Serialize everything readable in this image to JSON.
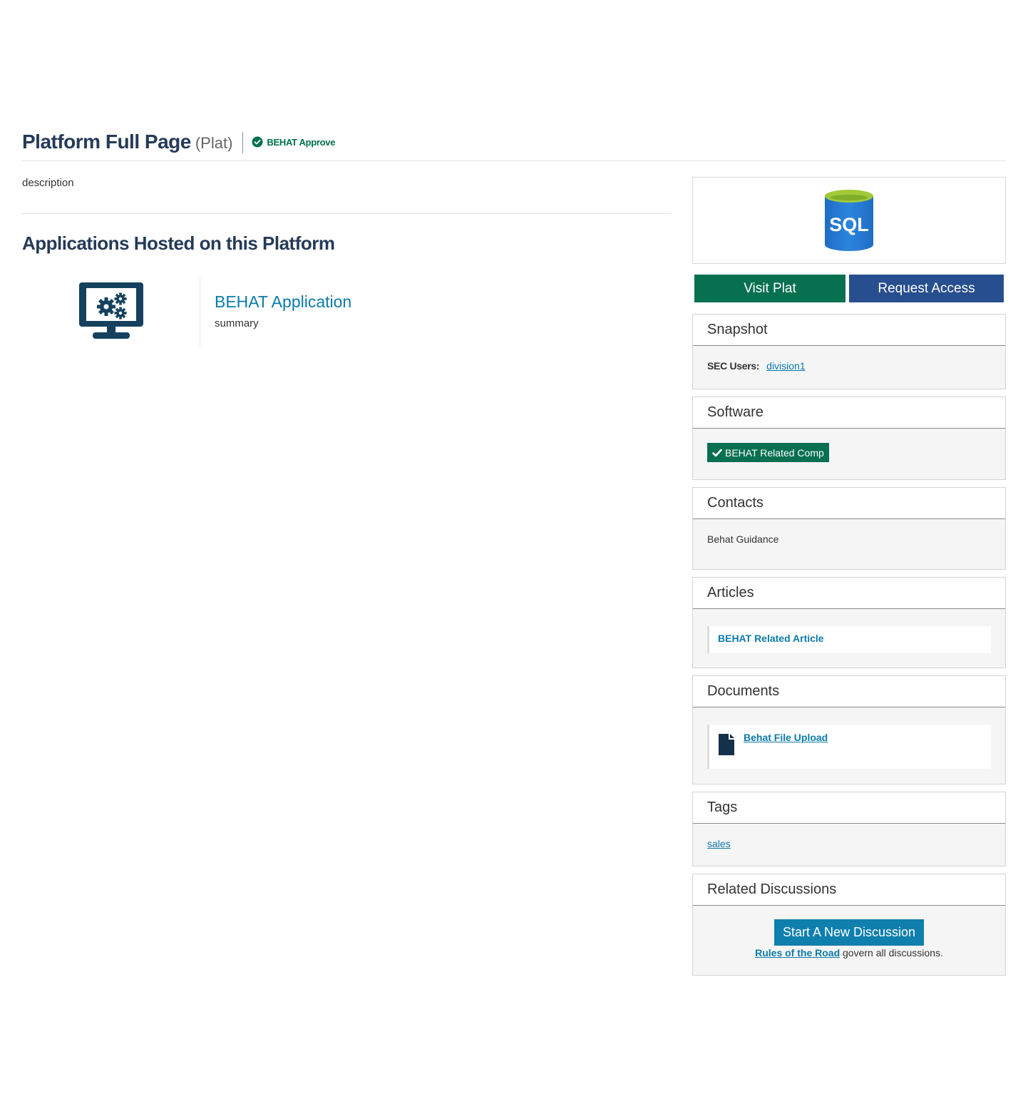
{
  "header": {
    "title": "Platform Full Page",
    "abbr": "(Plat)",
    "approval_status": "BEHAT Approve"
  },
  "main": {
    "description": "description",
    "applications_heading": "Applications Hosted on this Platform",
    "applications": [
      {
        "name": "BEHAT Application",
        "summary": "summary",
        "icon": "monitor-gears-icon"
      }
    ]
  },
  "sidebar": {
    "logo": {
      "text": "SQL",
      "icon": "sql-database-icon"
    },
    "buttons": {
      "visit_label": "Visit Plat",
      "request_label": "Request Access"
    },
    "snapshot": {
      "title": "Snapshot",
      "sec_users_label": "SEC Users:",
      "sec_users_value": "division1"
    },
    "software": {
      "title": "Software",
      "items": [
        "BEHAT Related Comp"
      ]
    },
    "contacts": {
      "title": "Contacts",
      "items": [
        "Behat Guidance"
      ]
    },
    "articles": {
      "title": "Articles",
      "items": [
        "BEHAT Related Article"
      ]
    },
    "documents": {
      "title": "Documents",
      "items": [
        "Behat File Upload"
      ]
    },
    "tags": {
      "title": "Tags",
      "items": [
        "sales"
      ]
    },
    "discussions": {
      "title": "Related Discussions",
      "button_label": "Start A New Discussion",
      "rules_link": "Rules of the Road",
      "rules_text": "govern all discussions."
    }
  },
  "colors": {
    "title": "#253a58",
    "link": "#0b7ba8",
    "green": "#06704f",
    "blue_button": "#274e8e",
    "discussion_button": "#0f7fad"
  }
}
